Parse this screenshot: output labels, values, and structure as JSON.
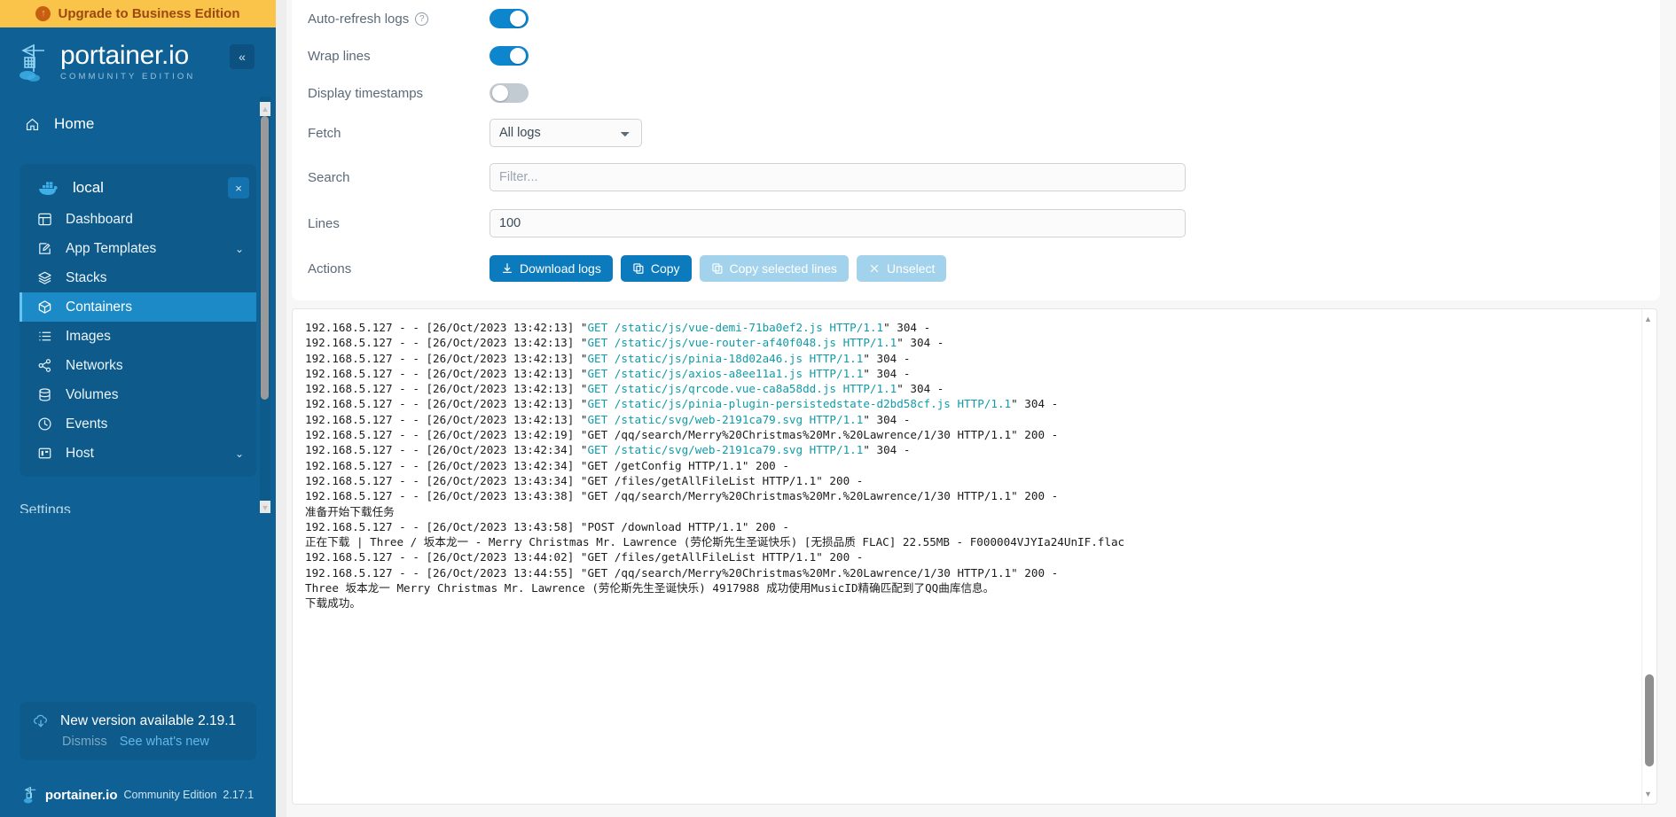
{
  "sidebar": {
    "upgrade_banner": {
      "label": "Upgrade to Business Edition",
      "icon": "up-arrow-circle-icon"
    },
    "brand": {
      "title": "portainer.io",
      "subtitle": "COMMUNITY EDITION"
    },
    "collapse_label": "«",
    "home": {
      "label": "Home",
      "icon": "home-icon"
    },
    "environment": {
      "name": "local",
      "icon": "docker-icon",
      "close_label": "×"
    },
    "items": [
      {
        "label": "Dashboard",
        "icon": "dashboard-icon",
        "active": false,
        "expandable": false
      },
      {
        "label": "App Templates",
        "icon": "edit-square-icon",
        "active": false,
        "expandable": true
      },
      {
        "label": "Stacks",
        "icon": "layers-icon",
        "active": false,
        "expandable": false
      },
      {
        "label": "Containers",
        "icon": "cube-icon",
        "active": true,
        "expandable": false
      },
      {
        "label": "Images",
        "icon": "list-icon",
        "active": false,
        "expandable": false
      },
      {
        "label": "Networks",
        "icon": "share-nodes-icon",
        "active": false,
        "expandable": false
      },
      {
        "label": "Volumes",
        "icon": "database-icon",
        "active": false,
        "expandable": false
      },
      {
        "label": "Events",
        "icon": "clock-icon",
        "active": false,
        "expandable": false
      },
      {
        "label": "Host",
        "icon": "server-icon",
        "active": false,
        "expandable": true
      }
    ],
    "settings_partial": "Settings",
    "version_notice": {
      "text": "New version available 2.19.1",
      "icon": "cloud-download-icon",
      "dismiss_label": "Dismiss",
      "whats_new_label": "See what's new"
    },
    "footer": {
      "name": "portainer.io",
      "edition": "Community Edition",
      "version": "2.17.1"
    }
  },
  "controls": {
    "auto_refresh": {
      "label": "Auto-refresh logs",
      "state": "on",
      "has_help": true
    },
    "wrap_lines": {
      "label": "Wrap lines",
      "state": "on",
      "has_help": false
    },
    "display_timestamps": {
      "label": "Display timestamps",
      "state": "off",
      "has_help": false
    },
    "fetch": {
      "label": "Fetch",
      "value": "All logs",
      "options": [
        "All logs"
      ]
    },
    "search": {
      "label": "Search",
      "value": "",
      "placeholder": "Filter..."
    },
    "lines": {
      "label": "Lines",
      "value": "100"
    },
    "actions": {
      "label": "Actions",
      "buttons": [
        {
          "label": "Download logs",
          "icon": "download-icon",
          "disabled": false
        },
        {
          "label": "Copy",
          "icon": "copy-icon",
          "disabled": false
        },
        {
          "label": "Copy selected lines",
          "icon": "copy-icon",
          "disabled": true
        },
        {
          "label": "Unselect",
          "icon": "close-icon",
          "disabled": true
        }
      ]
    }
  },
  "logs": {
    "lines": [
      {
        "prefix": "192.168.5.127 - - [26/Oct/2023 13:42:13] \"",
        "highlight": "GET /static/js/vue-demi-71ba0ef2.js HTTP/1.1",
        "suffix": "\" 304 -"
      },
      {
        "prefix": "192.168.5.127 - - [26/Oct/2023 13:42:13] \"",
        "highlight": "GET /static/js/vue-router-af40f048.js HTTP/1.1",
        "suffix": "\" 304 -"
      },
      {
        "prefix": "192.168.5.127 - - [26/Oct/2023 13:42:13] \"",
        "highlight": "GET /static/js/pinia-18d02a46.js HTTP/1.1",
        "suffix": "\" 304 -"
      },
      {
        "prefix": "192.168.5.127 - - [26/Oct/2023 13:42:13] \"",
        "highlight": "GET /static/js/axios-a8ee11a1.js HTTP/1.1",
        "suffix": "\" 304 -"
      },
      {
        "prefix": "192.168.5.127 - - [26/Oct/2023 13:42:13] \"",
        "highlight": "GET /static/js/qrcode.vue-ca8a58dd.js HTTP/1.1",
        "suffix": "\" 304 -"
      },
      {
        "prefix": "192.168.5.127 - - [26/Oct/2023 13:42:13] \"",
        "highlight": "GET /static/js/pinia-plugin-persistedstate-d2bd58cf.js HTTP/1.1",
        "suffix": "\" 304 -"
      },
      {
        "prefix": "192.168.5.127 - - [26/Oct/2023 13:42:13] \"",
        "highlight": "GET /static/svg/web-2191ca79.svg HTTP/1.1",
        "suffix": "\" 304 -"
      },
      {
        "prefix": "192.168.5.127 - - [26/Oct/2023 13:42:19] \"GET /qq/search/Merry%20Christmas%20Mr.%20Lawrence/1/30 HTTP/1.1\" 200 -",
        "highlight": "",
        "suffix": ""
      },
      {
        "prefix": "192.168.5.127 - - [26/Oct/2023 13:42:34] \"",
        "highlight": "GET /static/svg/web-2191ca79.svg HTTP/1.1",
        "suffix": "\" 304 -"
      },
      {
        "prefix": "192.168.5.127 - - [26/Oct/2023 13:42:34] \"GET /getConfig HTTP/1.1\" 200 -",
        "highlight": "",
        "suffix": ""
      },
      {
        "prefix": "192.168.5.127 - - [26/Oct/2023 13:43:34] \"GET /files/getAllFileList HTTP/1.1\" 200 -",
        "highlight": "",
        "suffix": ""
      },
      {
        "prefix": "192.168.5.127 - - [26/Oct/2023 13:43:38] \"GET /qq/search/Merry%20Christmas%20Mr.%20Lawrence/1/30 HTTP/1.1\" 200 -",
        "highlight": "",
        "suffix": ""
      },
      {
        "prefix": "准备开始下载任务",
        "highlight": "",
        "suffix": ""
      },
      {
        "prefix": "192.168.5.127 - - [26/Oct/2023 13:43:58] \"POST /download HTTP/1.1\" 200 -",
        "highlight": "",
        "suffix": ""
      },
      {
        "prefix": "正在下载 | Three / 坂本龙一 - Merry Christmas Mr. Lawrence (劳伦斯先生圣诞快乐) [无损品质 FLAC] 22.55MB - F000004VJYIa24UnIF.flac",
        "highlight": "",
        "suffix": ""
      },
      {
        "prefix": "192.168.5.127 - - [26/Oct/2023 13:44:02] \"GET /files/getAllFileList HTTP/1.1\" 200 -",
        "highlight": "",
        "suffix": ""
      },
      {
        "prefix": "192.168.5.127 - - [26/Oct/2023 13:44:55] \"GET /qq/search/Merry%20Christmas%20Mr.%20Lawrence/1/30 HTTP/1.1\" 200 -",
        "highlight": "",
        "suffix": ""
      },
      {
        "prefix": "Three 坂本龙一 Merry Christmas Mr. Lawrence (劳伦斯先生圣诞快乐) 4917988 成功使用MusicID精确匹配到了QQ曲库信息。",
        "highlight": "",
        "suffix": ""
      },
      {
        "prefix": "下载成功。",
        "highlight": "",
        "suffix": ""
      }
    ]
  },
  "colors": {
    "sidebar_bg": "#0f6195",
    "banner_bg": "#fac44b",
    "accent": "#0b7bbd",
    "active_nav": "#1b8ac6",
    "log_highlight": "#0f9ca8"
  }
}
